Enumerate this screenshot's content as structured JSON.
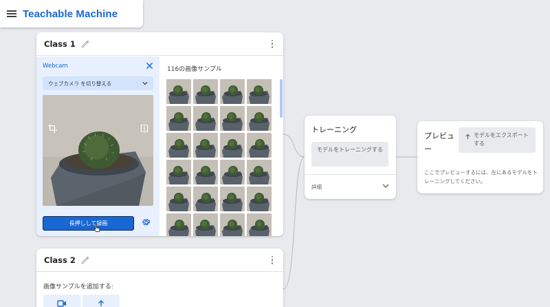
{
  "app": {
    "title": "Teachable Machine"
  },
  "class1": {
    "name": "Class 1",
    "webcam_label": "Webcam",
    "camera_select": "ウェブカメラ を切り替える",
    "record_button": "長押しして録画",
    "samples_count": "116の画像サンプル",
    "thumb_count": 24
  },
  "class2": {
    "name": "Class 2",
    "add_samples_label": "画像サンプルを追加する:"
  },
  "training": {
    "title": "トレーニング",
    "train_button": "モデルをトレーニングする",
    "details_label": "詳細"
  },
  "preview": {
    "title": "プレビュー",
    "export_button": "モデルをエクスポートする",
    "description": "ここでプレビューするには、左にあるモデルをトレーニングしてください。"
  },
  "colors": {
    "accent": "#1967d2",
    "background": "#e8eaed",
    "record_button": "#1967d2"
  },
  "icons": [
    "menu-icon",
    "pencil-icon",
    "more-vert-icon",
    "close-icon",
    "chevron-down-icon",
    "crop-icon",
    "flip-icon",
    "settings-icon",
    "video-icon",
    "upload-icon",
    "export-icon"
  ]
}
